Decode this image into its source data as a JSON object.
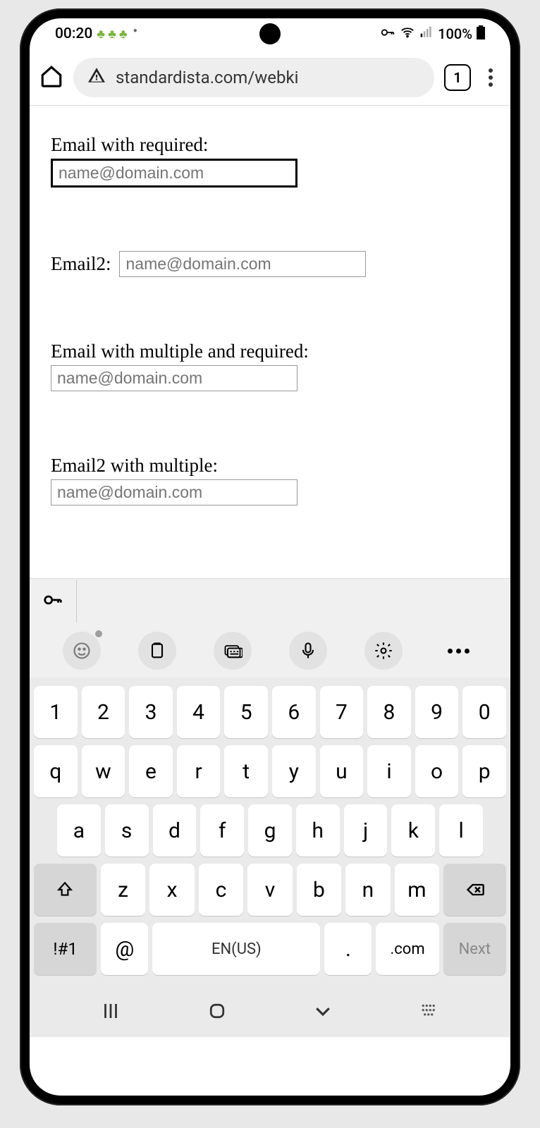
{
  "status": {
    "time": "00:20",
    "battery": "100%"
  },
  "browser": {
    "url": "standardista.com/webki",
    "tabs": "1"
  },
  "form": {
    "f1": {
      "label": "Email with required:",
      "placeholder": "name@domain.com"
    },
    "f2": {
      "label": "Email2:",
      "placeholder": "name@domain.com"
    },
    "f3": {
      "label": "Email with multiple and required:",
      "placeholder": "name@domain.com"
    },
    "f4": {
      "label": "Email2 with multiple:",
      "placeholder": "name@domain.com"
    }
  },
  "keyboard": {
    "row1": [
      "1",
      "2",
      "3",
      "4",
      "5",
      "6",
      "7",
      "8",
      "9",
      "0"
    ],
    "row2": [
      "q",
      "w",
      "e",
      "r",
      "t",
      "y",
      "u",
      "i",
      "o",
      "p"
    ],
    "row3": [
      "a",
      "s",
      "d",
      "f",
      "g",
      "h",
      "j",
      "k",
      "l"
    ],
    "row4": [
      "z",
      "x",
      "c",
      "v",
      "b",
      "n",
      "m"
    ],
    "sym": "!#1",
    "at": "@",
    "space": "EN(US)",
    "dot": ".",
    "com": ".com",
    "next": "Next"
  }
}
